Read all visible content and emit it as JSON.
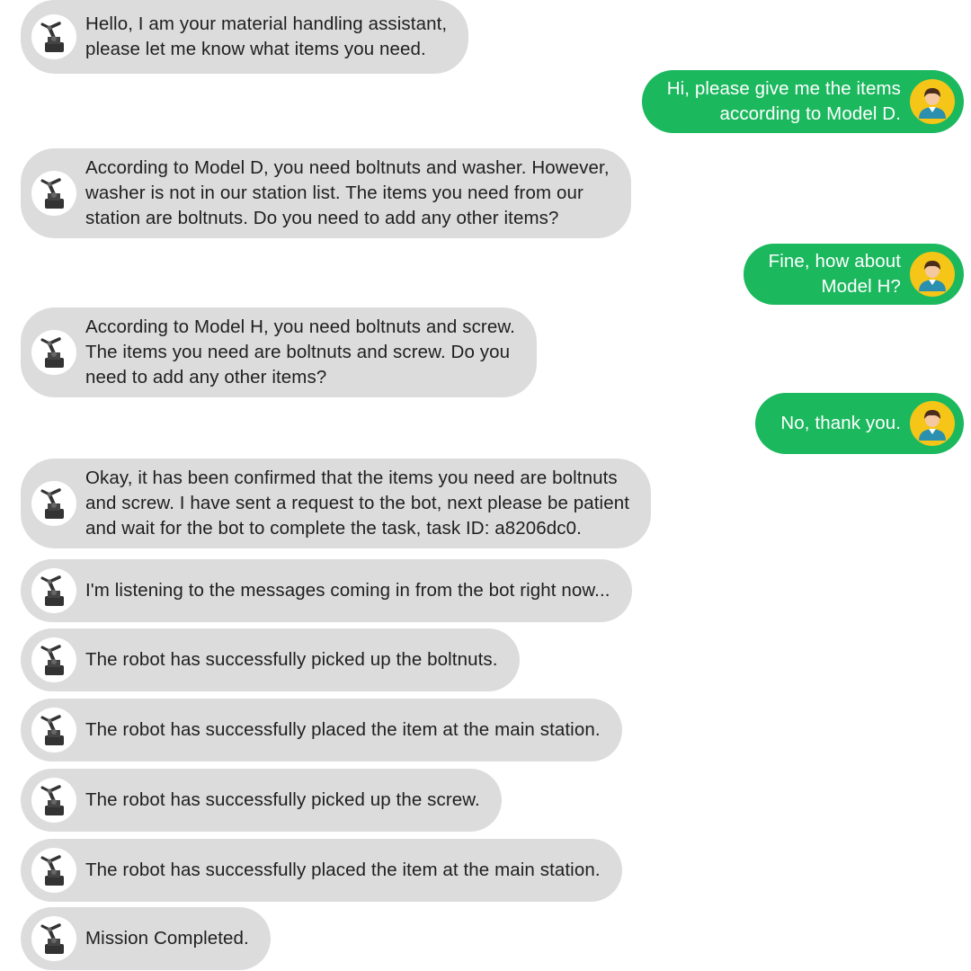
{
  "colors": {
    "bot_bubble": "#dcdcdc",
    "user_bubble": "#1bb85e",
    "user_avatar_bg": "#f5c518"
  },
  "icons": {
    "bot_avatar": "robot-arm-icon",
    "user_avatar": "person-icon"
  },
  "messages": [
    {
      "sender": "bot",
      "text": "Hello, I am your material handling assistant,\nplease let me know what items you need."
    },
    {
      "sender": "user",
      "text": "Hi, please give me the items\naccording to Model D."
    },
    {
      "sender": "bot",
      "text": "According to Model D, you need boltnuts and washer. However,\nwasher is not in our station list. The items you need from our\nstation are boltnuts. Do you need to add any other items?"
    },
    {
      "sender": "user",
      "text": "Fine, how about\nModel H?"
    },
    {
      "sender": "bot",
      "text": "According to Model H, you need boltnuts and screw.\nThe items you need are boltnuts and screw. Do you\nneed to add any other items?"
    },
    {
      "sender": "user",
      "text": "No, thank you."
    },
    {
      "sender": "bot",
      "text": "Okay, it has been confirmed that the items you need are boltnuts\nand screw. I have sent a request to the bot, next please be patient\nand wait for the bot to complete the task, task ID: a8206dc0."
    },
    {
      "sender": "bot",
      "text": "I'm listening to the messages coming in from the bot right now..."
    },
    {
      "sender": "bot",
      "text": "The robot has successfully picked up the boltnuts."
    },
    {
      "sender": "bot",
      "text": "The robot has successfully placed the item at the main station."
    },
    {
      "sender": "bot",
      "text": "The robot has successfully picked up the screw."
    },
    {
      "sender": "bot",
      "text": "The robot has successfully placed the item at the main station."
    },
    {
      "sender": "bot",
      "text": "Mission Completed."
    }
  ]
}
